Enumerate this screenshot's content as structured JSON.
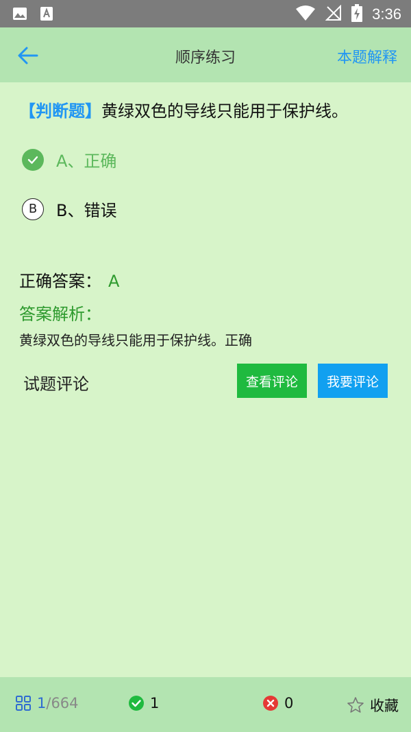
{
  "status_bar": {
    "time": "3:36",
    "icons": [
      "image-icon",
      "font-download-icon",
      "wifi-icon",
      "no-signal-icon",
      "battery-charging-icon"
    ]
  },
  "header": {
    "back_icon": "back-arrow-icon",
    "title": "顺序练习",
    "explain_label": "本题解释",
    "accent": "#2196f3"
  },
  "question": {
    "tag": "【判断题】",
    "text": "黄绿双色的导线只能用于保护线。"
  },
  "options": [
    {
      "letter": "A",
      "label": "A、正确",
      "selected": true,
      "correct": true
    },
    {
      "letter": "B",
      "label": "B、错误",
      "selected": false,
      "correct": false
    }
  ],
  "answer": {
    "label": "正确答案：",
    "value": "A"
  },
  "analysis": {
    "title": "答案解析：",
    "text": "黄绿双色的导线只能用于保护线。正确"
  },
  "comments": {
    "label": "试题评论",
    "view_button": "查看评论",
    "write_button": "我要评论"
  },
  "footer": {
    "progress_current": "1",
    "progress_total": "/664",
    "correct_count": "1",
    "wrong_count": "0",
    "favorite_label": "收藏"
  },
  "colors": {
    "background": "#d7f4c9",
    "bar": "#b3e4b1",
    "correct_green": "#5cb85c",
    "view_button": "#1fba3f",
    "write_button": "#11a0f0",
    "wrong_red": "#e53935"
  }
}
